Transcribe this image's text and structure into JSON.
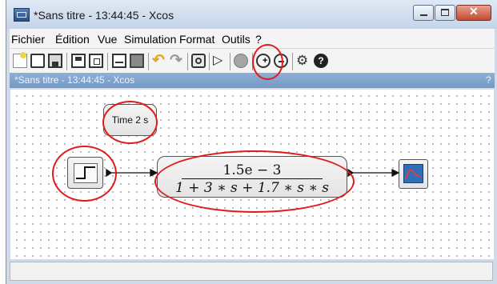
{
  "window": {
    "title": "*Sans titre - 13:44:45 - Xcos"
  },
  "menu": {
    "items": [
      "Fichier",
      "Édition",
      "Vue",
      "Simulation",
      "Format",
      "Outils",
      "?"
    ]
  },
  "toolbar": {
    "buttons": [
      "new-diagram-icon",
      "open-icon",
      "open-in-scilab-icon",
      "save-icon",
      "save-as-icon",
      "export-icon",
      "print-icon",
      "undo-icon",
      "redo-icon",
      "fit-diagram-icon",
      "start-icon",
      "stop-icon",
      "zoom-in-icon",
      "zoom-out-icon",
      "setup-icon",
      "help-icon"
    ]
  },
  "diagram": {
    "tab_title": "*Sans titre - 13:44:45 - Xcos",
    "tab_help": "?",
    "label_block": "Time 2 s",
    "transfer_function": {
      "numerator": "1.5e − 3",
      "denominator": "1 + 3 ∗ s + 1.7 ∗ s ∗ s"
    }
  },
  "colors": {
    "highlight": "#e01b1b",
    "scope_screen": "#2f6fb8",
    "title_bar": "#c4d4e8"
  }
}
